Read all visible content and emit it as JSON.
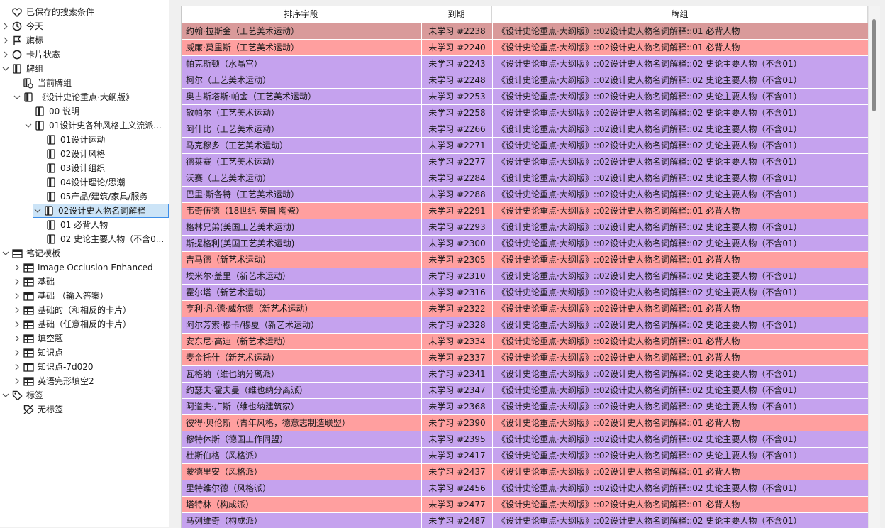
{
  "colors": {
    "row_red": "#ff9f9f",
    "row_red_first": "#d99a9a",
    "row_purple": "#c5a2ee",
    "selection": "#cce4f7"
  },
  "sidebar": {
    "items": [
      {
        "label": "已保存的搜索条件",
        "icon": "heart-icon",
        "level": 0,
        "expander": "none"
      },
      {
        "label": "今天",
        "icon": "clock-icon",
        "level": 0,
        "expander": "collapsed"
      },
      {
        "label": "旗标",
        "icon": "flag-icon",
        "level": 0,
        "expander": "collapsed"
      },
      {
        "label": "卡片状态",
        "icon": "circle-icon",
        "level": 0,
        "expander": "collapsed"
      },
      {
        "label": "牌组",
        "icon": "deck-icon",
        "level": 0,
        "expander": "expanded"
      },
      {
        "label": "当前牌组",
        "icon": "current-deck-icon",
        "level": 1,
        "expander": "none"
      },
      {
        "label": "《设计史论重点·大纲版》",
        "icon": "deck-icon",
        "level": 1,
        "expander": "expanded"
      },
      {
        "label": "00 说明",
        "icon": "deck-icon",
        "level": 2,
        "expander": "none"
      },
      {
        "label": "01设计史各种风格主义流派...",
        "icon": "deck-icon",
        "level": 2,
        "expander": "expanded"
      },
      {
        "label": "01设计运动",
        "icon": "deck-icon",
        "level": 3,
        "expander": "none"
      },
      {
        "label": "02设计风格",
        "icon": "deck-icon",
        "level": 3,
        "expander": "none"
      },
      {
        "label": "03设计组织",
        "icon": "deck-icon",
        "level": 3,
        "expander": "none"
      },
      {
        "label": "04设计理论/思潮",
        "icon": "deck-icon",
        "level": 3,
        "expander": "none"
      },
      {
        "label": "05产品/建筑/家具/服务",
        "icon": "deck-icon",
        "level": 3,
        "expander": "none"
      },
      {
        "label": "02设计史人物名词解释",
        "icon": "deck-icon",
        "level": 2,
        "expander": "expanded",
        "selected": true
      },
      {
        "label": "01 必背人物",
        "icon": "deck-icon",
        "level": 3,
        "expander": "none"
      },
      {
        "label": "02 史论主要人物（不含0...",
        "icon": "deck-icon",
        "level": 3,
        "expander": "none"
      },
      {
        "label": "笔记模板",
        "icon": "notetype-icon",
        "level": 0,
        "expander": "expanded"
      },
      {
        "label": "Image Occlusion Enhanced",
        "icon": "notetype-icon",
        "level": 1,
        "expander": "collapsed"
      },
      {
        "label": "基础",
        "icon": "notetype-icon",
        "level": 1,
        "expander": "collapsed"
      },
      {
        "label": "基础 （输入答案）",
        "icon": "notetype-icon",
        "level": 1,
        "expander": "collapsed"
      },
      {
        "label": "基础的（和相反的卡片）",
        "icon": "notetype-icon",
        "level": 1,
        "expander": "collapsed"
      },
      {
        "label": "基础（任意相反的卡片）",
        "icon": "notetype-icon",
        "level": 1,
        "expander": "collapsed"
      },
      {
        "label": "填空题",
        "icon": "notetype-icon",
        "level": 1,
        "expander": "collapsed"
      },
      {
        "label": "知识点",
        "icon": "notetype-icon",
        "level": 1,
        "expander": "collapsed"
      },
      {
        "label": "知识点-7d020",
        "icon": "notetype-icon",
        "level": 1,
        "expander": "collapsed"
      },
      {
        "label": "英语完形填空2",
        "icon": "notetype-icon",
        "level": 1,
        "expander": "collapsed"
      },
      {
        "label": "标签",
        "icon": "tag-icon",
        "level": 0,
        "expander": "expanded"
      },
      {
        "label": "无标签",
        "icon": "no-tag-icon",
        "level": 1,
        "expander": "none"
      }
    ]
  },
  "table": {
    "columns": [
      "排序字段",
      "到期",
      "牌组"
    ],
    "rows": [
      {
        "sort": "约翰·拉斯金（工艺美术运动）",
        "due": "未学习 #2238",
        "deck": "《设计史论重点·大纲版》::02设计史人物名词解释::01 必背人物",
        "color": "red"
      },
      {
        "sort": "威廉·莫里斯（工艺美术运动）",
        "due": "未学习 #2240",
        "deck": "《设计史论重点·大纲版》::02设计史人物名词解释::01 必背人物",
        "color": "red"
      },
      {
        "sort": "帕克斯顿（水晶宫）",
        "due": "未学习 #2243",
        "deck": "《设计史论重点·大纲版》::02设计史人物名词解释::02 史论主要人物（不含01）",
        "color": "purple"
      },
      {
        "sort": "柯尔（工艺美术运动）",
        "due": "未学习 #2248",
        "deck": "《设计史论重点·大纲版》::02设计史人物名词解释::02 史论主要人物（不含01）",
        "color": "purple"
      },
      {
        "sort": "奥古斯塔斯·帕金（工艺美术运动）",
        "due": "未学习 #2253",
        "deck": "《设计史论重点·大纲版》::02设计史人物名词解释::02 史论主要人物（不含01）",
        "color": "purple"
      },
      {
        "sort": "散帕尔（工艺美术运动）",
        "due": "未学习 #2258",
        "deck": "《设计史论重点·大纲版》::02设计史人物名词解释::02 史论主要人物（不含01）",
        "color": "purple"
      },
      {
        "sort": "阿什比（工艺美术运动）",
        "due": "未学习 #2266",
        "deck": "《设计史论重点·大纲版》::02设计史人物名词解释::02 史论主要人物（不含01）",
        "color": "purple"
      },
      {
        "sort": "马克穆多（工艺美术运动）",
        "due": "未学习 #2271",
        "deck": "《设计史论重点·大纲版》::02设计史人物名词解释::02 史论主要人物（不含01）",
        "color": "purple"
      },
      {
        "sort": "德莱赛（工艺美术运动）",
        "due": "未学习 #2277",
        "deck": "《设计史论重点·大纲版》::02设计史人物名词解释::02 史论主要人物（不含01）",
        "color": "purple"
      },
      {
        "sort": "沃赛（工艺美术运动）",
        "due": "未学习 #2284",
        "deck": "《设计史论重点·大纲版》::02设计史人物名词解释::02 史论主要人物（不含01）",
        "color": "purple"
      },
      {
        "sort": "巴里·斯各特（工艺美术运动）",
        "due": "未学习 #2288",
        "deck": "《设计史论重点·大纲版》::02设计史人物名词解释::02 史论主要人物（不含01）",
        "color": "purple"
      },
      {
        "sort": "韦奇伍德（18世纪 英国 陶瓷）",
        "due": "未学习 #2291",
        "deck": "《设计史论重点·大纲版》::02设计史人物名词解释::01 必背人物",
        "color": "red"
      },
      {
        "sort": "格林兄弟(美国工艺美术运动)",
        "due": "未学习 #2293",
        "deck": "《设计史论重点·大纲版》::02设计史人物名词解释::02 史论主要人物（不含01）",
        "color": "purple"
      },
      {
        "sort": "斯提格利(美国工艺美术运动)",
        "due": "未学习 #2300",
        "deck": "《设计史论重点·大纲版》::02设计史人物名词解释::02 史论主要人物（不含01）",
        "color": "purple"
      },
      {
        "sort": "吉马德（新艺术运动）",
        "due": "未学习 #2305",
        "deck": "《设计史论重点·大纲版》::02设计史人物名词解释::01 必背人物",
        "color": "red"
      },
      {
        "sort": "埃米尔·盖里（新艺术运动）",
        "due": "未学习 #2310",
        "deck": "《设计史论重点·大纲版》::02设计史人物名词解释::02 史论主要人物（不含01）",
        "color": "purple"
      },
      {
        "sort": "霍尔塔（新艺术运动）",
        "due": "未学习 #2316",
        "deck": "《设计史论重点·大纲版》::02设计史人物名词解释::02 史论主要人物（不含01）",
        "color": "purple"
      },
      {
        "sort": "亨利·凡·德·威尔德（新艺术运动）",
        "due": "未学习 #2322",
        "deck": "《设计史论重点·大纲版》::02设计史人物名词解释::01 必背人物",
        "color": "red"
      },
      {
        "sort": "阿尔芳索·穆卡/穆夏（新艺术运动）",
        "due": "未学习 #2328",
        "deck": "《设计史论重点·大纲版》::02设计史人物名词解释::02 史论主要人物（不含01）",
        "color": "purple"
      },
      {
        "sort": "安东尼·高迪（新艺术运动）",
        "due": "未学习 #2334",
        "deck": "《设计史论重点·大纲版》::02设计史人物名词解释::01 必背人物",
        "color": "red"
      },
      {
        "sort": "麦金托什（新艺术运动）",
        "due": "未学习 #2337",
        "deck": "《设计史论重点·大纲版》::02设计史人物名词解释::01 必背人物",
        "color": "red"
      },
      {
        "sort": "瓦格纳（维也纳分离派）",
        "due": "未学习 #2341",
        "deck": "《设计史论重点·大纲版》::02设计史人物名词解释::02 史论主要人物（不含01）",
        "color": "purple"
      },
      {
        "sort": "约瑟夫·霍夫曼（维也纳分离派）",
        "due": "未学习 #2347",
        "deck": "《设计史论重点·大纲版》::02设计史人物名词解释::02 史论主要人物（不含01）",
        "color": "purple"
      },
      {
        "sort": "阿道夫·卢斯（维也纳建筑家）",
        "due": "未学习 #2368",
        "deck": "《设计史论重点·大纲版》::02设计史人物名词解释::02 史论主要人物（不含01）",
        "color": "purple"
      },
      {
        "sort": "彼得·贝伦斯（青年风格，德意志制造联盟）",
        "due": "未学习 #2390",
        "deck": "《设计史论重点·大纲版》::02设计史人物名词解释::01 必背人物",
        "color": "red"
      },
      {
        "sort": "穆特休斯（德国工作同盟）",
        "due": "未学习 #2395",
        "deck": "《设计史论重点·大纲版》::02设计史人物名词解释::02 史论主要人物（不含01）",
        "color": "purple"
      },
      {
        "sort": "杜斯伯格（风格派）",
        "due": "未学习 #2417",
        "deck": "《设计史论重点·大纲版》::02设计史人物名词解释::02 史论主要人物（不含01）",
        "color": "purple"
      },
      {
        "sort": "蒙德里安（风格派）",
        "due": "未学习 #2437",
        "deck": "《设计史论重点·大纲版》::02设计史人物名词解释::01 必背人物",
        "color": "red"
      },
      {
        "sort": "里特维尔德（风格派）",
        "due": "未学习 #2456",
        "deck": "《设计史论重点·大纲版》::02设计史人物名词解释::02 史论主要人物（不含01）",
        "color": "purple"
      },
      {
        "sort": "塔特林（构成派）",
        "due": "未学习 #2477",
        "deck": "《设计史论重点·大纲版》::02设计史人物名词解释::01 必背人物",
        "color": "red"
      },
      {
        "sort": "马列维奇（构成派）",
        "due": "未学习 #2487",
        "deck": "《设计史论重点·大纲版》::02设计史人物名词解释::02 史论主要人物（不含01）",
        "color": "purple"
      }
    ]
  }
}
